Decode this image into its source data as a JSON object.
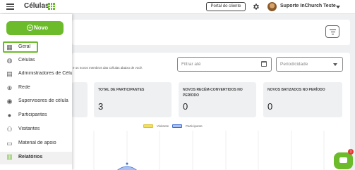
{
  "header": {
    "title": "Células",
    "portal_label": "Portal do cliente",
    "user_name": "Suporte InChurch Teste"
  },
  "sidebar": {
    "new_label": "Novo",
    "items": [
      {
        "label": "Geral",
        "icon": "dashboard-icon"
      },
      {
        "label": "Células",
        "icon": "globe-icon"
      },
      {
        "label": "Administradores de Célula",
        "icon": "admin-icon"
      },
      {
        "label": "Rede",
        "icon": "network-icon"
      },
      {
        "label": "Supervisores de célula",
        "icon": "supervisor-icon"
      },
      {
        "label": "Participantes",
        "icon": "participants-icon"
      },
      {
        "label": "Visitantes",
        "icon": "visitors-icon"
      },
      {
        "label": "Material de apoio",
        "icon": "folder-icon"
      },
      {
        "label": "Relatórios",
        "icon": "report-icon"
      }
    ]
  },
  "main": {
    "description": "e os novos membros das Células abaixo de você.",
    "filter_date_placeholder": "Filtrar até",
    "periodicity_placeholder": "Periodicidade",
    "stats": [
      {
        "label": "",
        "value": ""
      },
      {
        "label": "TOTAL DE PARTICIPANTES",
        "value": "3"
      },
      {
        "label": "NOVOS RECÉM-CONVERTIDOS NO PERÍODO",
        "value": "0"
      },
      {
        "label": "NOVOS BATIZADOS NO PERÍODO",
        "value": "0"
      }
    ],
    "legend": {
      "visitor": "Visitante",
      "participant": "Participante"
    }
  },
  "chat": {
    "badge": "1"
  },
  "colors": {
    "brand_green": "#6cbb2b",
    "visitor_swatch": "#f3e05a",
    "participant_swatch": "#a9c1f2",
    "badge_red": "#e53935"
  }
}
